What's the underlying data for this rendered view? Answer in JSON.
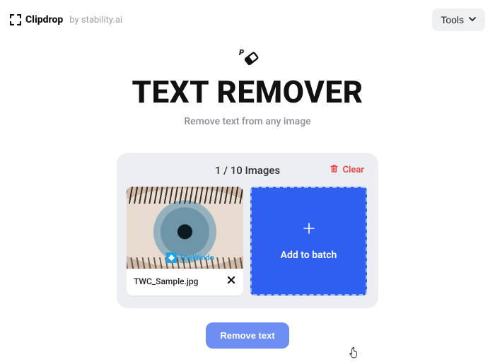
{
  "header": {
    "logo_name": "Clipdrop",
    "logo_by": "by stability.ai",
    "tools_label": "Tools"
  },
  "main": {
    "title": "TEXT REMOVER",
    "subtitle": "Remove text from any image"
  },
  "panel": {
    "counter": "1 / 10 Images",
    "clear_label": "Clear",
    "file_name": "TWC_Sample.jpg",
    "overlay_text": "TheWindo",
    "add_label": "Add to batch"
  },
  "action": {
    "remove_label": "Remove text"
  }
}
